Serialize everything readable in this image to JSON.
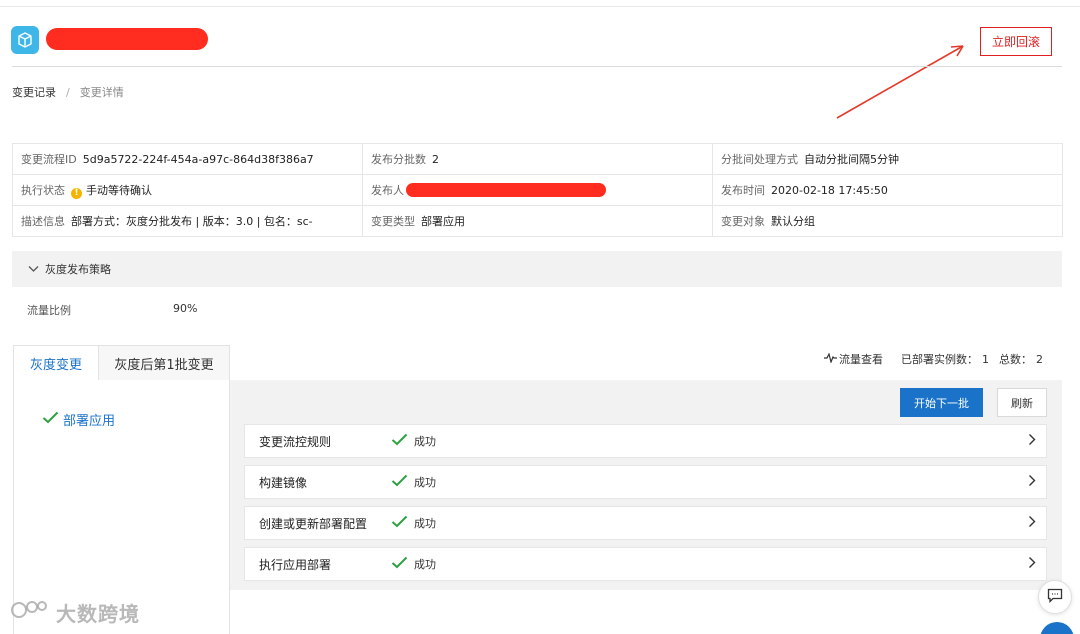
{
  "header": {
    "app_name_redacted": true,
    "rollback_label": "立即回滚",
    "accent_color": "#e02020"
  },
  "breadcrumb": {
    "root": "变更记录",
    "separator": "/",
    "current": "变更详情"
  },
  "info": {
    "process_id_label": "变更流程ID",
    "process_id_value": "5d9a5722-224f-454a-a97c-864d38f386a7",
    "batches_label": "发布分批数",
    "batches_value": "2",
    "batch_mode_label": "分批间处理方式",
    "batch_mode_value": "自动分批间隔5分钟",
    "exec_status_label": "执行状态",
    "exec_status_value": "手动等待确认",
    "publisher_label": "发布人",
    "publish_time_label": "发布时间",
    "publish_time_value": "2020-02-18 17:45:50",
    "desc_label": "描述信息",
    "desc_value": "部署方式：灰度分批发布 | 版本：3.0 | 包名：sc-",
    "change_type_label": "变更类型",
    "change_type_value": "部署应用",
    "change_target_label": "变更对象",
    "change_target_value": "默认分组"
  },
  "strategy": {
    "title": "灰度发布策略",
    "traffic_label": "流量比例",
    "traffic_value": "90%"
  },
  "tabs": [
    {
      "label": "灰度变更"
    },
    {
      "label": "灰度后第1批变更"
    }
  ],
  "meta": {
    "traffic_view": "流量查看",
    "deployed_label": "已部署实例数：",
    "deployed_value": "1",
    "total_label": "总数：",
    "total_value": "2"
  },
  "left_step": {
    "label": "部署应用"
  },
  "actions": {
    "next_batch": "开始下一批",
    "refresh": "刷新"
  },
  "steps": [
    {
      "name": "变更流控规则",
      "status": "成功"
    },
    {
      "name": "构建镜像",
      "status": "成功"
    },
    {
      "name": "创建或更新部署配置",
      "status": "成功"
    },
    {
      "name": "执行应用部署",
      "status": "成功"
    }
  ],
  "watermark": "大数跨境",
  "colors": {
    "primary": "#1a73c9",
    "success": "#2ea043",
    "warning": "#f5b400",
    "redaction": "#ff2c1f"
  }
}
